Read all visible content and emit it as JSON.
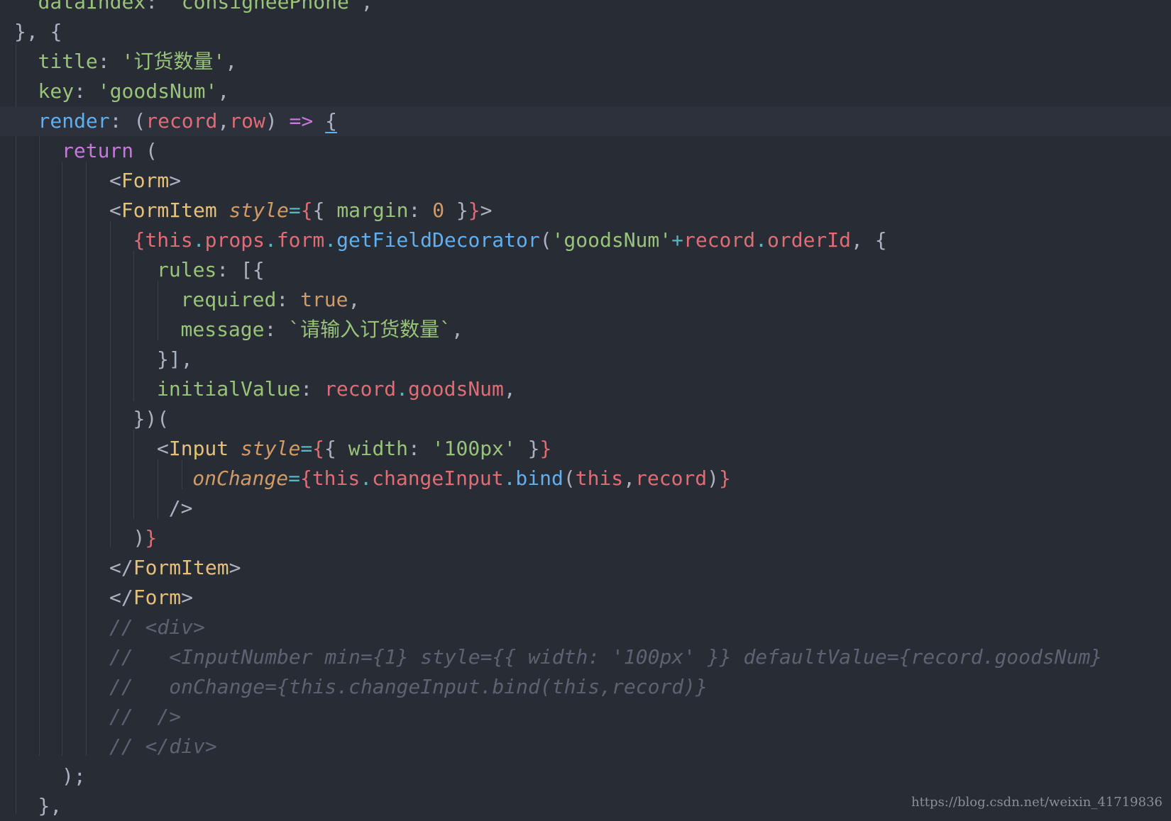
{
  "editor": {
    "lines": [
      {
        "indent": 1,
        "tokens": [
          [
            "key",
            "dataIndex"
          ],
          [
            "punct",
            ": "
          ],
          [
            "str",
            "'consigneePhone'"
          ],
          [
            "punct",
            ","
          ]
        ]
      },
      {
        "indent": 0,
        "tokens": [
          [
            "punct",
            "}, {"
          ]
        ]
      },
      {
        "indent": 1,
        "tokens": [
          [
            "key",
            "title"
          ],
          [
            "punct",
            ": "
          ],
          [
            "str",
            "'订货数量'"
          ],
          [
            "punct",
            ","
          ]
        ]
      },
      {
        "indent": 1,
        "tokens": [
          [
            "key",
            "key"
          ],
          [
            "punct",
            ": "
          ],
          [
            "str",
            "'goodsNum'"
          ],
          [
            "punct",
            ","
          ]
        ]
      },
      {
        "indent": 1,
        "cursor": true,
        "tokens": [
          [
            "fn",
            "render"
          ],
          [
            "punct",
            ": ("
          ],
          [
            "var",
            "record"
          ],
          [
            "punct",
            ","
          ],
          [
            "var",
            "row"
          ],
          [
            "punct",
            ") "
          ],
          [
            "kw",
            "=>"
          ],
          [
            "punct",
            " "
          ],
          [
            "underline",
            "{"
          ]
        ]
      },
      {
        "indent": 2,
        "tokens": [
          [
            "kw",
            "return"
          ],
          [
            "punct",
            " ("
          ]
        ]
      },
      {
        "indent": 4,
        "tokens": [
          [
            "punct",
            "<"
          ],
          [
            "tag",
            "Form"
          ],
          [
            "punct",
            ">"
          ]
        ]
      },
      {
        "indent": 4,
        "tokens": [
          [
            "punct",
            "<"
          ],
          [
            "tag",
            "FormItem"
          ],
          [
            "punct",
            " "
          ],
          [
            "attr",
            "style"
          ],
          [
            "op",
            "="
          ],
          [
            "brace",
            "{"
          ],
          [
            "punct",
            "{ "
          ],
          [
            "key",
            "margin"
          ],
          [
            "punct",
            ": "
          ],
          [
            "num",
            "0"
          ],
          [
            "punct",
            " }"
          ],
          [
            "brace",
            "}"
          ],
          [
            "punct",
            ">"
          ]
        ]
      },
      {
        "indent": 5,
        "tokens": [
          [
            "brace",
            "{"
          ],
          [
            "var",
            "this"
          ],
          [
            "op",
            "."
          ],
          [
            "var",
            "props"
          ],
          [
            "op",
            "."
          ],
          [
            "var",
            "form"
          ],
          [
            "op",
            "."
          ],
          [
            "fn",
            "getFieldDecorator"
          ],
          [
            "punct",
            "("
          ],
          [
            "str",
            "'goodsNum'"
          ],
          [
            "op",
            "+"
          ],
          [
            "var",
            "record"
          ],
          [
            "op",
            "."
          ],
          [
            "var",
            "orderId"
          ],
          [
            "punct",
            ", {"
          ]
        ]
      },
      {
        "indent": 6,
        "tokens": [
          [
            "key",
            "rules"
          ],
          [
            "punct",
            ": [{"
          ]
        ]
      },
      {
        "indent": 7,
        "tokens": [
          [
            "key",
            "required"
          ],
          [
            "punct",
            ": "
          ],
          [
            "bool",
            "true"
          ],
          [
            "punct",
            ","
          ]
        ]
      },
      {
        "indent": 7,
        "tokens": [
          [
            "key",
            "message"
          ],
          [
            "punct",
            ": "
          ],
          [
            "str",
            "`请输入订货数量`"
          ],
          [
            "punct",
            ","
          ]
        ]
      },
      {
        "indent": 6,
        "tokens": [
          [
            "punct",
            "}],"
          ]
        ]
      },
      {
        "indent": 6,
        "tokens": [
          [
            "key",
            "initialValue"
          ],
          [
            "punct",
            ": "
          ],
          [
            "var",
            "record"
          ],
          [
            "op",
            "."
          ],
          [
            "var",
            "goodsNum"
          ],
          [
            "punct",
            ","
          ]
        ]
      },
      {
        "indent": 5,
        "tokens": [
          [
            "punct",
            "})("
          ]
        ]
      },
      {
        "indent": 6,
        "tokens": [
          [
            "punct",
            "<"
          ],
          [
            "tag",
            "Input"
          ],
          [
            "punct",
            " "
          ],
          [
            "attr",
            "style"
          ],
          [
            "op",
            "="
          ],
          [
            "brace",
            "{"
          ],
          [
            "punct",
            "{ "
          ],
          [
            "key",
            "width"
          ],
          [
            "punct",
            ": "
          ],
          [
            "str",
            "'100px'"
          ],
          [
            "punct",
            " }"
          ],
          [
            "brace",
            "}"
          ]
        ]
      },
      {
        "indent": 7.5,
        "tokens": [
          [
            "attr",
            "onChange"
          ],
          [
            "op",
            "="
          ],
          [
            "brace",
            "{"
          ],
          [
            "var",
            "this"
          ],
          [
            "op",
            "."
          ],
          [
            "var",
            "changeInput"
          ],
          [
            "op",
            "."
          ],
          [
            "fn",
            "bind"
          ],
          [
            "punct",
            "("
          ],
          [
            "var",
            "this"
          ],
          [
            "punct",
            ","
          ],
          [
            "var",
            "record"
          ],
          [
            "punct",
            ")"
          ],
          [
            "brace",
            "}"
          ]
        ]
      },
      {
        "indent": 6.5,
        "tokens": [
          [
            "punct",
            "/>"
          ]
        ]
      },
      {
        "indent": 5,
        "tokens": [
          [
            "punct",
            ")"
          ],
          [
            "brace",
            "}"
          ]
        ]
      },
      {
        "indent": 4,
        "tokens": [
          [
            "punct",
            "</"
          ],
          [
            "tag",
            "FormItem"
          ],
          [
            "punct",
            ">"
          ]
        ]
      },
      {
        "indent": 4,
        "tokens": [
          [
            "punct",
            "</"
          ],
          [
            "tag",
            "Form"
          ],
          [
            "punct",
            ">"
          ]
        ]
      },
      {
        "indent": 4,
        "tokens": [
          [
            "comment",
            "// <div>"
          ]
        ]
      },
      {
        "indent": 4,
        "tokens": [
          [
            "comment",
            "//   <InputNumber min={1} style={{ width: '100px' }} defaultValue={record.goodsNum}"
          ]
        ]
      },
      {
        "indent": 4,
        "tokens": [
          [
            "comment",
            "//   onChange={this.changeInput.bind(this,record)}"
          ]
        ]
      },
      {
        "indent": 4,
        "tokens": [
          [
            "comment",
            "//  />"
          ]
        ]
      },
      {
        "indent": 4,
        "tokens": [
          [
            "comment",
            "// </div>"
          ]
        ]
      },
      {
        "indent": 2,
        "tokens": [
          [
            "punct",
            ");"
          ]
        ]
      },
      {
        "indent": 1,
        "tokens": [
          [
            "punct",
            "},"
          ]
        ]
      }
    ]
  },
  "watermark": {
    "text": "https://blog.csdn.net/weixin_41719836"
  }
}
